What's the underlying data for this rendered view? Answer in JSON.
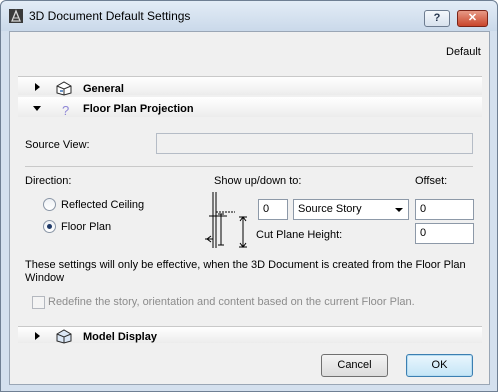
{
  "window": {
    "title": "3D Document Default Settings",
    "help_label": "?",
    "close_label": "✕"
  },
  "header": {
    "default_label": "Default"
  },
  "sections": {
    "general": {
      "title": "General"
    },
    "floor_plan_projection": {
      "title": "Floor Plan Projection"
    },
    "model_display": {
      "title": "Model Display"
    }
  },
  "source_view": {
    "label": "Source View:",
    "value": ""
  },
  "direction": {
    "label": "Direction:",
    "options": [
      {
        "label": "Reflected Ceiling",
        "selected": false
      },
      {
        "label": "Floor Plan",
        "selected": true
      }
    ]
  },
  "show_updown": {
    "label": "Show up/down to:",
    "value": "0",
    "story_select": "Source Story",
    "cut_plane_label": "Cut Plane Height:"
  },
  "offset": {
    "label": "Offset:",
    "value": "0",
    "cut_plane_value": "0"
  },
  "note": {
    "line1": "These settings will only be effective, when the 3D Document is created from the Floor Plan",
    "line2": "Window"
  },
  "redefine": {
    "label": "Redefine the story, orientation and content based on the current Floor Plan.",
    "checked": false,
    "enabled": false
  },
  "buttons": {
    "cancel": "Cancel",
    "ok": "OK"
  }
}
